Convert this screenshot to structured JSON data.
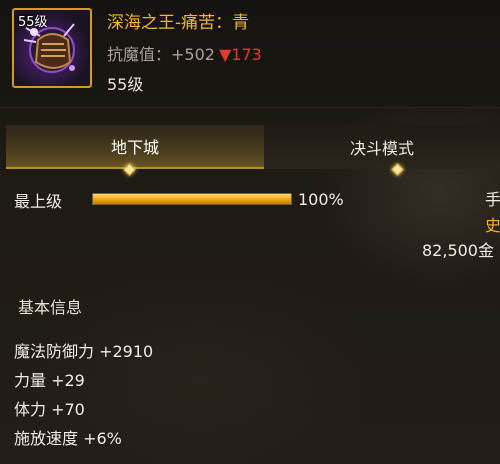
{
  "item": {
    "icon_name": "dark-gauntlet-icon",
    "icon_level": "55级",
    "name": "深海之王-痛苦：青",
    "stat_label": "抗魔值：",
    "stat_value": "+502",
    "stat_change": "▼173",
    "level": "55级"
  },
  "tabs": [
    {
      "label": "地下城",
      "active": true
    },
    {
      "label": "决斗模式",
      "active": false
    }
  ],
  "progress": {
    "label": "最上级",
    "percent_text": "100%",
    "fill_fraction": 1.0
  },
  "side_panel": {
    "line1": "手",
    "line2": "史",
    "price": "82,500金"
  },
  "basic_info": {
    "title": "基本信息",
    "stats": [
      "魔法防御力 +2910",
      "力量 +29",
      "体力 +70",
      "施放速度 +6%"
    ]
  },
  "colors": {
    "accent_gold": "#f5b82a",
    "icon_border": "#d79a1e",
    "decrease_red": "#e23a2e",
    "progress_fill": "#f0a614"
  }
}
